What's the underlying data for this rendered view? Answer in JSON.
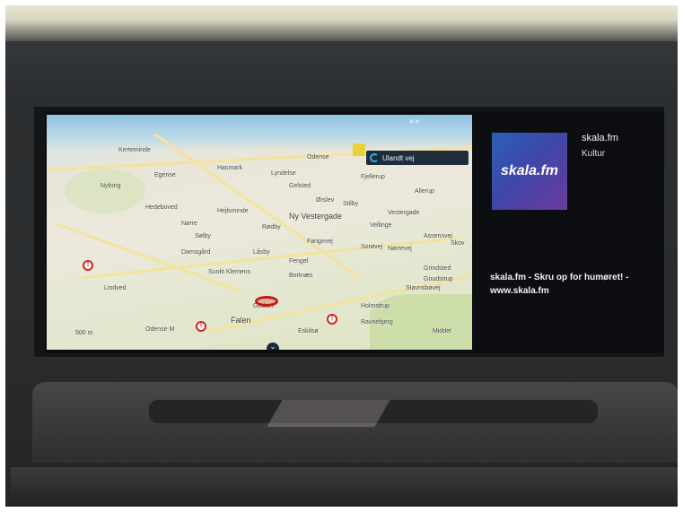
{
  "map": {
    "reroute_label": "Ulandt vej",
    "places": [
      {
        "name": "Kerteminde",
        "cls": ""
      },
      {
        "name": "Hasmark",
        "cls": ""
      },
      {
        "name": "Egense",
        "cls": ""
      },
      {
        "name": "Nyborg",
        "cls": ""
      },
      {
        "name": "Odense",
        "cls": ""
      },
      {
        "name": "Lyndelse",
        "cls": ""
      },
      {
        "name": "Gelsted",
        "cls": ""
      },
      {
        "name": "Fjellerup",
        "cls": ""
      },
      {
        "name": "Hedeboved",
        "cls": ""
      },
      {
        "name": "Hejlsminde",
        "cls": ""
      },
      {
        "name": "Ørslev",
        "cls": ""
      },
      {
        "name": "Ny Vestergade",
        "cls": "big"
      },
      {
        "name": "Stilby",
        "cls": ""
      },
      {
        "name": "Allerup",
        "cls": ""
      },
      {
        "name": "Nørre",
        "cls": ""
      },
      {
        "name": "Sølby",
        "cls": ""
      },
      {
        "name": "Rødby",
        "cls": ""
      },
      {
        "name": "Vestergade",
        "cls": ""
      },
      {
        "name": "Vellinge",
        "cls": ""
      },
      {
        "name": "Assensvej",
        "cls": ""
      },
      {
        "name": "Fangevej",
        "cls": ""
      },
      {
        "name": "Sorøvej",
        "cls": ""
      },
      {
        "name": "Nørrevej",
        "cls": ""
      },
      {
        "name": "Grindsted",
        "cls": ""
      },
      {
        "name": "Lindved",
        "cls": ""
      },
      {
        "name": "Damsgård",
        "cls": ""
      },
      {
        "name": "Låsby",
        "cls": ""
      },
      {
        "name": "Fengel",
        "cls": ""
      },
      {
        "name": "Bortnæs",
        "cls": ""
      },
      {
        "name": "Sunkt Klemens",
        "cls": ""
      },
      {
        "name": "Stavnsbøvej",
        "cls": ""
      },
      {
        "name": "Goudstrup",
        "cls": ""
      },
      {
        "name": "Holmstrup",
        "cls": ""
      },
      {
        "name": "Falen",
        "cls": "big"
      },
      {
        "name": "Godset",
        "cls": ""
      },
      {
        "name": "Ravnebjerg",
        "cls": ""
      },
      {
        "name": "Eskilsø",
        "cls": ""
      },
      {
        "name": "Odense M",
        "cls": ""
      },
      {
        "name": "Middel",
        "cls": ""
      },
      {
        "name": "Skov",
        "cls": ""
      }
    ],
    "scale_label": "500 m"
  },
  "media": {
    "logo_text": "skala.fm",
    "station": "skala.fm",
    "genre": "Kultur",
    "slogan": "skala.fm - Skru op for humøret! - www.skala.fm"
  },
  "colors": {
    "accent": "#27b0e8",
    "pin": "#d2231f",
    "route": "#c41717",
    "cover_start": "#2b60b8",
    "cover_end": "#6b3a9d"
  }
}
